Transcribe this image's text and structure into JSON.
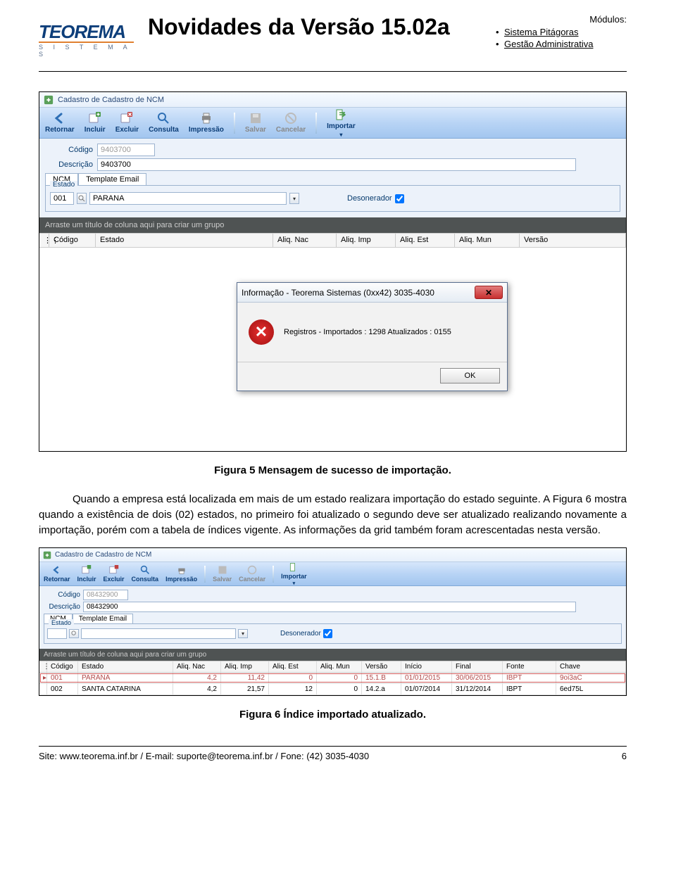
{
  "header": {
    "logo_main": "TEOREMA",
    "logo_sub": "S I S T E M A S",
    "title": "Novidades da Versão 15.02a",
    "mod_label": "Módulos:",
    "mods": [
      "Sistema Pitágoras",
      "Gestão Administrativa"
    ]
  },
  "shot1": {
    "window_title": "Cadastro de Cadastro de NCM",
    "toolbar": [
      "Retornar",
      "Incluir",
      "Excluir",
      "Consulta",
      "Impressão",
      "Salvar",
      "Cancelar",
      "Importar"
    ],
    "f_codigo_lbl": "Código",
    "f_codigo_val": "9403700",
    "f_desc_lbl": "Descrição",
    "f_desc_val": "9403700",
    "tabs": [
      "NCM",
      "Template Email"
    ],
    "estado_lbl": "Estado",
    "estado_code": "001",
    "estado_name": "PARANA",
    "deso_lbl": "Desonerador",
    "grp_hint": "Arraste um título de coluna aqui para criar um grupo",
    "grid_cols": [
      "Código",
      "Estado",
      "Aliq. Nac",
      "Aliq. Imp",
      "Aliq. Est",
      "Aliq. Mun",
      "Versão"
    ],
    "dlg_title": "Informação - Teorema Sistemas (0xx42) 3035-4030",
    "dlg_msg": "Registros - Importados : 1298 Atualizados : 0155",
    "dlg_ok": "OK"
  },
  "cap1": "Figura 5 Mensagem de sucesso de importação.",
  "p1": "Quando a empresa está localizada em mais de um estado realizara importação do estado seguinte. A Figura 6 mostra quando a existência de dois (02) estados, no primeiro foi atualizado o segundo deve ser atualizado realizando novamente a importação, porém com a tabela de índices vigente. As informações da grid também foram acrescentadas nesta versão.",
  "shot2": {
    "window_title": "Cadastro de Cadastro de NCM",
    "toolbar": [
      "Retornar",
      "Incluir",
      "Excluir",
      "Consulta",
      "Impressão",
      "Salvar",
      "Cancelar",
      "Importar"
    ],
    "f_codigo_lbl": "Código",
    "f_codigo_val": "08432900",
    "f_desc_lbl": "Descrição",
    "f_desc_val": "08432900",
    "tabs": [
      "NCM",
      "Template Email"
    ],
    "estado_lbl": "Estado",
    "deso_lbl": "Desonerador",
    "grp_hint": "Arraste um título de coluna aqui para criar um grupo",
    "grid_cols": [
      "Código",
      "Estado",
      "Aliq. Nac",
      "Aliq. Imp",
      "Aliq. Est",
      "Aliq. Mun",
      "Versão",
      "Início",
      "Final",
      "Fonte",
      "Chave"
    ],
    "rows": [
      [
        "001",
        "PARANA",
        "4,2",
        "11,42",
        "0",
        "0",
        "15.1.B",
        "01/01/2015",
        "30/06/2015",
        "IBPT",
        "9oi3aC"
      ],
      [
        "002",
        "SANTA CATARINA",
        "4,2",
        "21,57",
        "12",
        "0",
        "14.2.a",
        "01/07/2014",
        "31/12/2014",
        "IBPT",
        "6ed75L"
      ]
    ]
  },
  "cap2": "Figura 6 Índice importado atualizado.",
  "footer": {
    "left": "Site: www.teorema.inf.br / E-mail: suporte@teorema.inf.br / Fone: (42) 3035-4030",
    "right": "6"
  }
}
